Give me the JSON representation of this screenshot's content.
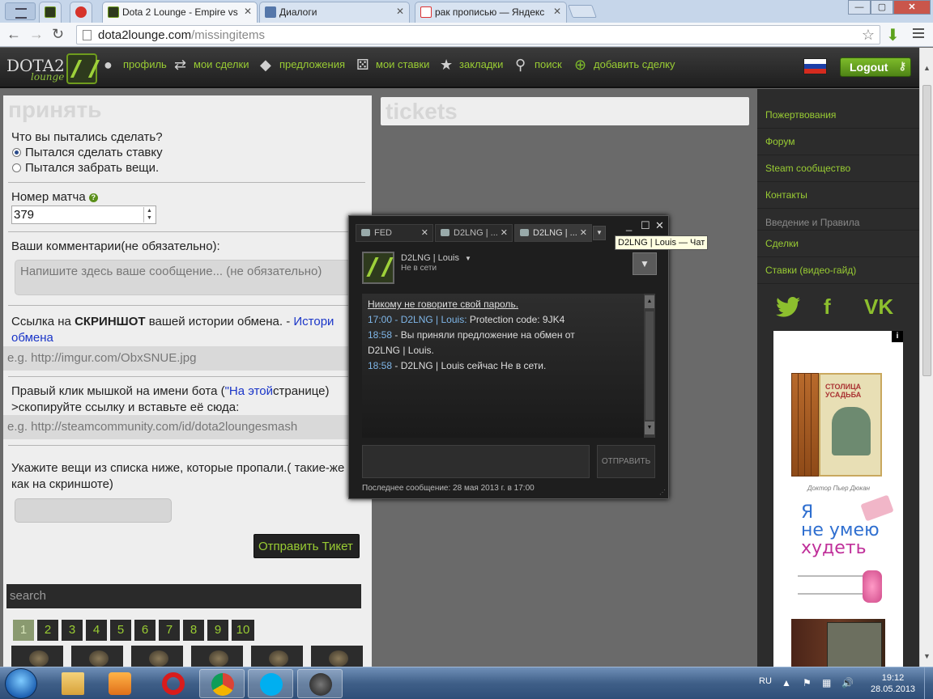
{
  "browser": {
    "tabs": [
      {
        "label": "Dota 2 Lounge - Empire vs",
        "active": true
      },
      {
        "label": "Диалоги",
        "active": false
      },
      {
        "label": "рак прописью — Яндекс",
        "active": false
      }
    ],
    "window_controls": [
      "—",
      "▢",
      "✕"
    ],
    "address": {
      "host": "dota2lounge.com",
      "path": "/missingitems"
    }
  },
  "site": {
    "logo": {
      "word": "DOTA2",
      "sub": "lounge"
    },
    "nav": [
      {
        "label": "профиль",
        "icon": "user-icon"
      },
      {
        "label": "мои сделки",
        "icon": "trade-icon"
      },
      {
        "label": "предложения",
        "icon": "tag-icon"
      },
      {
        "label": "мои ставки",
        "icon": "dice-icon"
      },
      {
        "label": "закладки",
        "icon": "star-icon"
      },
      {
        "label": "поиск",
        "icon": "search-icon"
      },
      {
        "label": "добавить сделку",
        "icon": "plus-circle-icon"
      }
    ],
    "logout_label": "Logout"
  },
  "form": {
    "ghost_title": "принять",
    "question": "Что вы пытались сделать?",
    "options": [
      "Пытался сделать ставку",
      "Пытался забрать вещи."
    ],
    "selected_option": 0,
    "match_label": "Номер матча",
    "match_value": "379",
    "comments_label": "Ваши комментарии(не обязательно):",
    "comments_placeholder": "Напишите здесь ваше сообщение... (не обязательно)",
    "screenshot_label_pre": "Ссылка на ",
    "screenshot_label_bold": "СКРИНШОТ",
    "screenshot_label_post": " вашей истории обмена. - ",
    "screenshot_link": "Истори",
    "screenshot_link_cont": "обмена",
    "screenshot_placeholder": "e.g. http://imgur.com/ObxSNUE.jpg",
    "bot_label_pre": "Правый клик мышкой на имени бота (",
    "bot_label_link": "\"На этой",
    "bot_label_post": "странице)",
    "bot_label_line2": ">скопируйте ссылку и вставьте её сюда:",
    "bot_placeholder": "e.g. http://steamcommunity.com/id/dota2loungesmash",
    "items_label_line1": "Укажите вещи из списка ниже, которые пропали.( такие-же",
    "items_label_line2": "как на скриншоте)",
    "submit_label": "Отправить Тикет",
    "search_placeholder": "search",
    "pages": [
      "1",
      "2",
      "3",
      "4",
      "5",
      "6",
      "7",
      "8",
      "9",
      "10"
    ],
    "current_page": "1"
  },
  "tickets": {
    "ghost_title": "tickets"
  },
  "sidebar": {
    "links": [
      "Пожертвования",
      "Форум",
      "Steam сообщество",
      "Контакты"
    ],
    "section_label": "Введение и Правила",
    "links2": [
      "Сделки",
      "Ставки (видео-гайд)"
    ],
    "social": [
      "twitter-icon",
      "facebook-icon",
      "vk-icon"
    ],
    "social_text": [
      "f",
      "VK"
    ],
    "ad": {
      "info": "i",
      "book1_title": "СТОЛИЦА УСАДЬБА",
      "author": "Доктор Пьер Дюкан",
      "title_line1": "Я",
      "title_line2": "не умею",
      "title_line3": "худеть"
    }
  },
  "chat": {
    "tabs": [
      {
        "label": "FED",
        "active": false
      },
      {
        "label": "D2LNG | ...",
        "active": false
      },
      {
        "label": "D2LNG | ...",
        "active": true
      }
    ],
    "tooltip": "D2LNG | Louis — Чат",
    "name": "D2LNG | Louis",
    "status": "Не в сети",
    "warning": "Никому не говорите свой пароль.",
    "messages": [
      {
        "time": "17:00",
        "sender": "D2LNG | Louis:",
        "text": " Protection code: 9JK4"
      },
      {
        "time": "18:58",
        "sender": "",
        "text": " - Вы приняли предложение на обмен от"
      },
      {
        "time": "",
        "sender": "",
        "text": "D2LNG | Louis."
      },
      {
        "time": "18:58",
        "sender": "",
        "text": " - D2LNG | Louis сейчас Не в сети."
      }
    ],
    "send_label": "ОТПРАВИТЬ",
    "footer": "Последнее сообщение: 28 мая 2013 г. в 17:00"
  },
  "taskbar": {
    "apps": [
      "explorer-icon",
      "media-player-icon",
      "opera-icon",
      "chrome-icon",
      "skype-icon",
      "steam-icon"
    ],
    "lang": "RU",
    "time": "19:12",
    "date": "28.05.2013"
  },
  "colors": {
    "accent_green": "#99cc33",
    "link_blue": "#1a35c8",
    "chat_time": "#7fb6e8"
  }
}
